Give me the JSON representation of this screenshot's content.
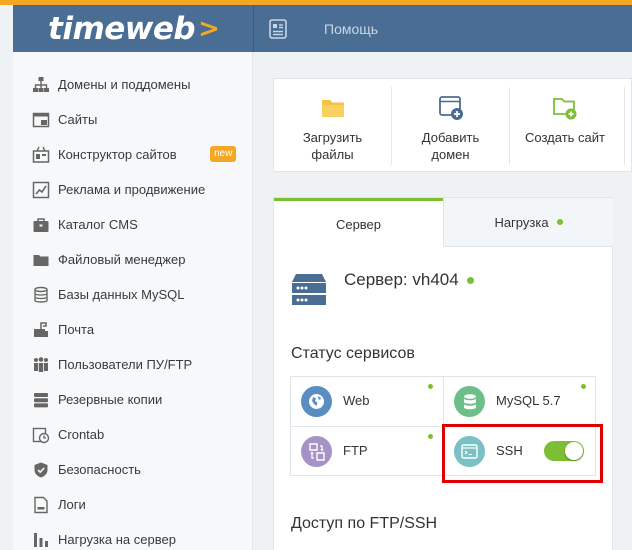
{
  "header": {
    "logo_text": "timeweb",
    "logo_arrow": ">",
    "help_label": "Помощь",
    "accent_color": "#f5a623",
    "bar_color": "#4a6d94"
  },
  "sidebar": {
    "items": [
      {
        "label": "Домены и поддомены",
        "icon": "sitemap-icon"
      },
      {
        "label": "Сайты",
        "icon": "browser-window-icon"
      },
      {
        "label": "Конструктор сайтов",
        "icon": "constructor-icon",
        "badge": "new"
      },
      {
        "label": "Реклама и продвижение",
        "icon": "chart-line-icon"
      },
      {
        "label": "Каталог CMS",
        "icon": "briefcase-icon"
      },
      {
        "label": "Файловый менеджер",
        "icon": "folder-icon"
      },
      {
        "label": "Базы данных MySQL",
        "icon": "database-icon"
      },
      {
        "label": "Почта",
        "icon": "mailbox-icon"
      },
      {
        "label": "Пользователи ПУ/FTP",
        "icon": "users-icon"
      },
      {
        "label": "Резервные копии",
        "icon": "server-stack-icon"
      },
      {
        "label": "Crontab",
        "icon": "clock-calendar-icon"
      },
      {
        "label": "Безопасность",
        "icon": "shield-icon"
      },
      {
        "label": "Логи",
        "icon": "log-document-icon"
      },
      {
        "label": "Нагрузка на сервер",
        "icon": "bar-chart-icon"
      }
    ]
  },
  "quick_actions": [
    {
      "label_line1": "Загрузить",
      "label_line2": "файлы",
      "icon": "upload-folder-icon"
    },
    {
      "label_line1": "Добавить",
      "label_line2": "домен",
      "icon": "add-domain-icon"
    },
    {
      "label_line1": "Создать сайт",
      "label_line2": "",
      "icon": "create-site-folder-icon"
    }
  ],
  "tabs": {
    "server": "Сервер",
    "load": "Нагрузка"
  },
  "server": {
    "title": "Сервер: vh404",
    "status_heading": "Статус сервисов",
    "access_heading": "Доступ по FTP/SSH"
  },
  "services": [
    {
      "label": "Web",
      "icon": "globe-icon",
      "color": "#5b8ec0"
    },
    {
      "label": "MySQL 5.7",
      "icon": "database-icon",
      "color": "#6dbf8a"
    },
    {
      "label": "FTP",
      "icon": "file-transfer-icon",
      "color": "#a593c8"
    },
    {
      "label": "SSH",
      "icon": "terminal-icon",
      "color": "#7ac0c4",
      "enabled": true
    }
  ]
}
